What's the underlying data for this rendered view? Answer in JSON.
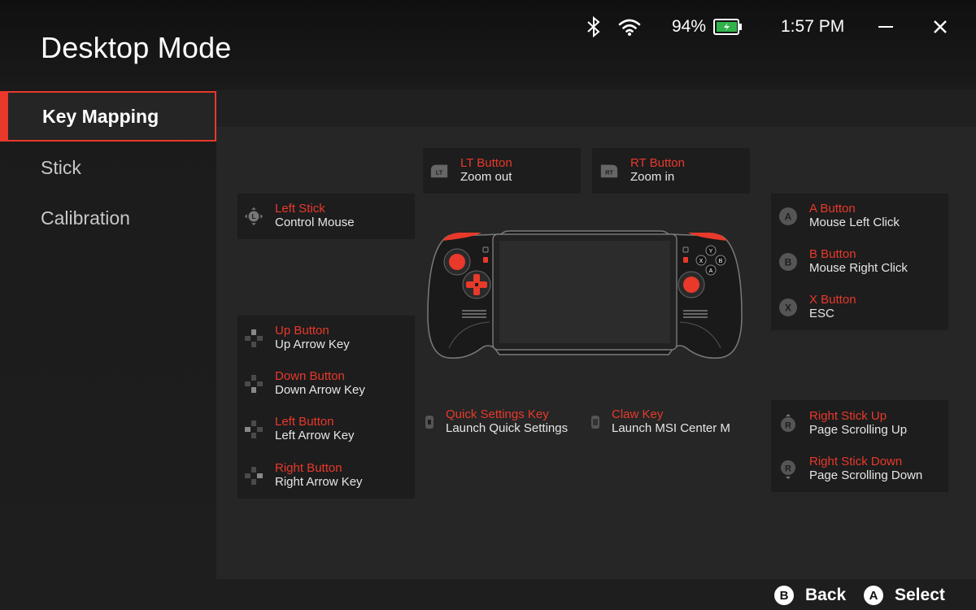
{
  "window": {
    "title": "Desktop Mode",
    "battery_percent": "94%",
    "time": "1:57 PM",
    "icons": [
      "bluetooth-icon",
      "wifi-icon",
      "battery-icon",
      "minimize-icon",
      "close-icon"
    ]
  },
  "sidebar": {
    "items": [
      {
        "label": "Key Mapping",
        "active": true
      },
      {
        "label": "Stick",
        "active": false
      },
      {
        "label": "Calibration",
        "active": false
      }
    ]
  },
  "mapping": {
    "lt": {
      "key": "LT Button",
      "value": "Zoom out"
    },
    "rt": {
      "key": "RT Button",
      "value": "Zoom in"
    },
    "left_stick": {
      "key": "Left Stick",
      "value": "Control Mouse"
    },
    "a": {
      "key": "A Button",
      "value": "Mouse Left Click"
    },
    "b": {
      "key": "B Button",
      "value": "Mouse Right Click"
    },
    "x": {
      "key": "X Button",
      "value": "ESC"
    },
    "up": {
      "key": "Up Button",
      "value": "Up Arrow Key"
    },
    "down": {
      "key": "Down Button",
      "value": "Down Arrow Key"
    },
    "left": {
      "key": "Left Button",
      "value": "Left Arrow Key"
    },
    "right": {
      "key": "Right Button",
      "value": "Right Arrow Key"
    },
    "quick_settings": {
      "key": "Quick Settings Key",
      "value": "Launch Quick Settings"
    },
    "claw": {
      "key": "Claw Key",
      "value": "Launch MSI Center M"
    },
    "rs_up": {
      "key": "Right Stick Up",
      "value": "Page Scrolling Up"
    },
    "rs_down": {
      "key": "Right Stick Down",
      "value": "Page Scrolling Down"
    }
  },
  "icon_glyphs": {
    "lt": "LT",
    "rt": "RT",
    "a_badge": "A",
    "b_badge": "B",
    "x_badge": "X",
    "y_badge": "Y",
    "rs_badge": "R"
  },
  "footer": {
    "back_badge": "B",
    "back_label": "Back",
    "select_badge": "A",
    "select_label": "Select"
  },
  "colors": {
    "accent": "#e8392b",
    "background": "#1e1e1e",
    "panel": "#262626",
    "card": "#1d1d1d"
  }
}
